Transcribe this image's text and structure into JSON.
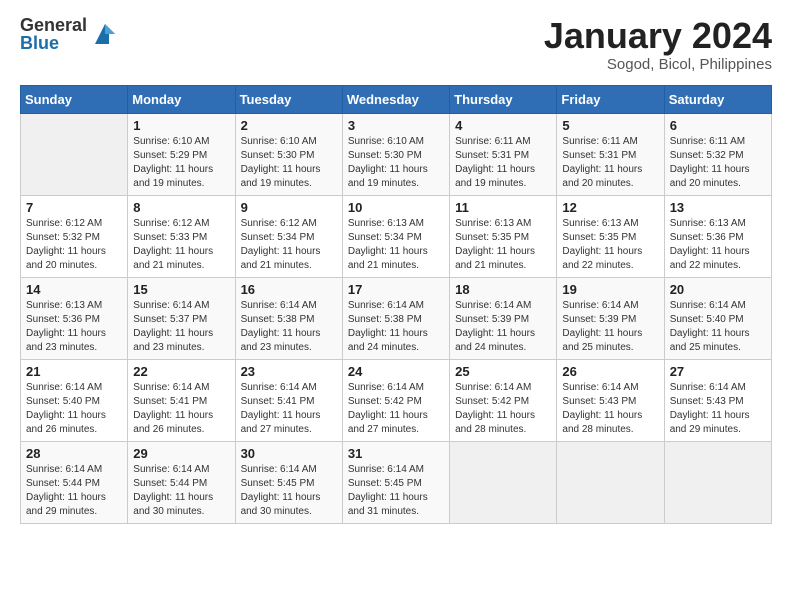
{
  "logo": {
    "general": "General",
    "blue": "Blue"
  },
  "title": "January 2024",
  "subtitle": "Sogod, Bicol, Philippines",
  "days": [
    "Sunday",
    "Monday",
    "Tuesday",
    "Wednesday",
    "Thursday",
    "Friday",
    "Saturday"
  ],
  "weeks": [
    [
      {
        "day": "",
        "info": ""
      },
      {
        "day": "1",
        "info": "Sunrise: 6:10 AM\nSunset: 5:29 PM\nDaylight: 11 hours\nand 19 minutes."
      },
      {
        "day": "2",
        "info": "Sunrise: 6:10 AM\nSunset: 5:30 PM\nDaylight: 11 hours\nand 19 minutes."
      },
      {
        "day": "3",
        "info": "Sunrise: 6:10 AM\nSunset: 5:30 PM\nDaylight: 11 hours\nand 19 minutes."
      },
      {
        "day": "4",
        "info": "Sunrise: 6:11 AM\nSunset: 5:31 PM\nDaylight: 11 hours\nand 19 minutes."
      },
      {
        "day": "5",
        "info": "Sunrise: 6:11 AM\nSunset: 5:31 PM\nDaylight: 11 hours\nand 20 minutes."
      },
      {
        "day": "6",
        "info": "Sunrise: 6:11 AM\nSunset: 5:32 PM\nDaylight: 11 hours\nand 20 minutes."
      }
    ],
    [
      {
        "day": "7",
        "info": "Sunrise: 6:12 AM\nSunset: 5:32 PM\nDaylight: 11 hours\nand 20 minutes."
      },
      {
        "day": "8",
        "info": "Sunrise: 6:12 AM\nSunset: 5:33 PM\nDaylight: 11 hours\nand 21 minutes."
      },
      {
        "day": "9",
        "info": "Sunrise: 6:12 AM\nSunset: 5:34 PM\nDaylight: 11 hours\nand 21 minutes."
      },
      {
        "day": "10",
        "info": "Sunrise: 6:13 AM\nSunset: 5:34 PM\nDaylight: 11 hours\nand 21 minutes."
      },
      {
        "day": "11",
        "info": "Sunrise: 6:13 AM\nSunset: 5:35 PM\nDaylight: 11 hours\nand 21 minutes."
      },
      {
        "day": "12",
        "info": "Sunrise: 6:13 AM\nSunset: 5:35 PM\nDaylight: 11 hours\nand 22 minutes."
      },
      {
        "day": "13",
        "info": "Sunrise: 6:13 AM\nSunset: 5:36 PM\nDaylight: 11 hours\nand 22 minutes."
      }
    ],
    [
      {
        "day": "14",
        "info": "Sunrise: 6:13 AM\nSunset: 5:36 PM\nDaylight: 11 hours\nand 23 minutes."
      },
      {
        "day": "15",
        "info": "Sunrise: 6:14 AM\nSunset: 5:37 PM\nDaylight: 11 hours\nand 23 minutes."
      },
      {
        "day": "16",
        "info": "Sunrise: 6:14 AM\nSunset: 5:38 PM\nDaylight: 11 hours\nand 23 minutes."
      },
      {
        "day": "17",
        "info": "Sunrise: 6:14 AM\nSunset: 5:38 PM\nDaylight: 11 hours\nand 24 minutes."
      },
      {
        "day": "18",
        "info": "Sunrise: 6:14 AM\nSunset: 5:39 PM\nDaylight: 11 hours\nand 24 minutes."
      },
      {
        "day": "19",
        "info": "Sunrise: 6:14 AM\nSunset: 5:39 PM\nDaylight: 11 hours\nand 25 minutes."
      },
      {
        "day": "20",
        "info": "Sunrise: 6:14 AM\nSunset: 5:40 PM\nDaylight: 11 hours\nand 25 minutes."
      }
    ],
    [
      {
        "day": "21",
        "info": "Sunrise: 6:14 AM\nSunset: 5:40 PM\nDaylight: 11 hours\nand 26 minutes."
      },
      {
        "day": "22",
        "info": "Sunrise: 6:14 AM\nSunset: 5:41 PM\nDaylight: 11 hours\nand 26 minutes."
      },
      {
        "day": "23",
        "info": "Sunrise: 6:14 AM\nSunset: 5:41 PM\nDaylight: 11 hours\nand 27 minutes."
      },
      {
        "day": "24",
        "info": "Sunrise: 6:14 AM\nSunset: 5:42 PM\nDaylight: 11 hours\nand 27 minutes."
      },
      {
        "day": "25",
        "info": "Sunrise: 6:14 AM\nSunset: 5:42 PM\nDaylight: 11 hours\nand 28 minutes."
      },
      {
        "day": "26",
        "info": "Sunrise: 6:14 AM\nSunset: 5:43 PM\nDaylight: 11 hours\nand 28 minutes."
      },
      {
        "day": "27",
        "info": "Sunrise: 6:14 AM\nSunset: 5:43 PM\nDaylight: 11 hours\nand 29 minutes."
      }
    ],
    [
      {
        "day": "28",
        "info": "Sunrise: 6:14 AM\nSunset: 5:44 PM\nDaylight: 11 hours\nand 29 minutes."
      },
      {
        "day": "29",
        "info": "Sunrise: 6:14 AM\nSunset: 5:44 PM\nDaylight: 11 hours\nand 30 minutes."
      },
      {
        "day": "30",
        "info": "Sunrise: 6:14 AM\nSunset: 5:45 PM\nDaylight: 11 hours\nand 30 minutes."
      },
      {
        "day": "31",
        "info": "Sunrise: 6:14 AM\nSunset: 5:45 PM\nDaylight: 11 hours\nand 31 minutes."
      },
      {
        "day": "",
        "info": ""
      },
      {
        "day": "",
        "info": ""
      },
      {
        "day": "",
        "info": ""
      }
    ]
  ]
}
